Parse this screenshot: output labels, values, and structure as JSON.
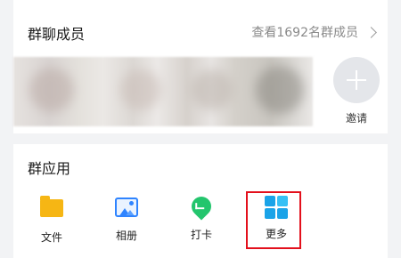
{
  "members": {
    "title": "群聊成员",
    "view_all": "查看1692名群成员",
    "invite_label": "邀请"
  },
  "apps": {
    "title": "群应用",
    "items": [
      {
        "label": "文件",
        "icon": "folder-icon"
      },
      {
        "label": "相册",
        "icon": "album-icon"
      },
      {
        "label": "打卡",
        "icon": "checkin-icon"
      },
      {
        "label": "更多",
        "icon": "grid-icon"
      }
    ]
  },
  "colors": {
    "folder": "#f6b614",
    "album": "#2f84ff",
    "checkin": "#23c56d",
    "more": "#1aa3e8",
    "highlight": "#e3101c"
  }
}
